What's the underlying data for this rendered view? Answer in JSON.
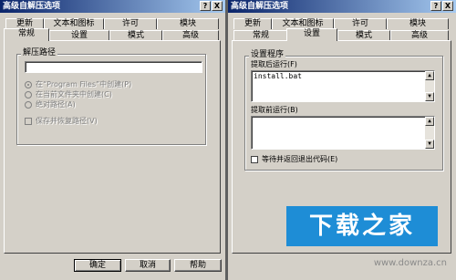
{
  "left_dialog": {
    "title": "高级自解压选项",
    "title_buttons": [
      "?",
      "X"
    ],
    "tabs_back": [
      "更新",
      "文本和图标",
      "许可",
      "模块"
    ],
    "tabs_front": [
      "常规",
      "设置",
      "模式",
      "高级"
    ],
    "active_tab": "常规",
    "group_label": "解压路径",
    "path_value": "",
    "options": [
      "在“Program Files”中创建(P)",
      "在当前文件夹中创建(C)",
      "绝对路径(A)"
    ],
    "save_path_label": "保存并恢复路径(V)"
  },
  "right_dialog": {
    "title": "高级自解压选项",
    "title_buttons": [
      "?",
      "X"
    ],
    "tabs_back": [
      "更新",
      "文本和图标",
      "许可",
      "模块"
    ],
    "tabs_front": [
      "常规",
      "设置",
      "模式",
      "高级"
    ],
    "active_tab": "设置",
    "group_label": "设置程序",
    "run_after_label": "提取后运行(F)",
    "run_after_value": "install.bat",
    "run_before_label": "提取前运行(B)",
    "run_before_value": "",
    "wait_label": "等待并返回退出代码(E)"
  },
  "buttons": {
    "ok": "确定",
    "cancel": "取消",
    "help": "帮助"
  },
  "watermark": {
    "text": "下载之家",
    "url": "www.downza.cn"
  }
}
